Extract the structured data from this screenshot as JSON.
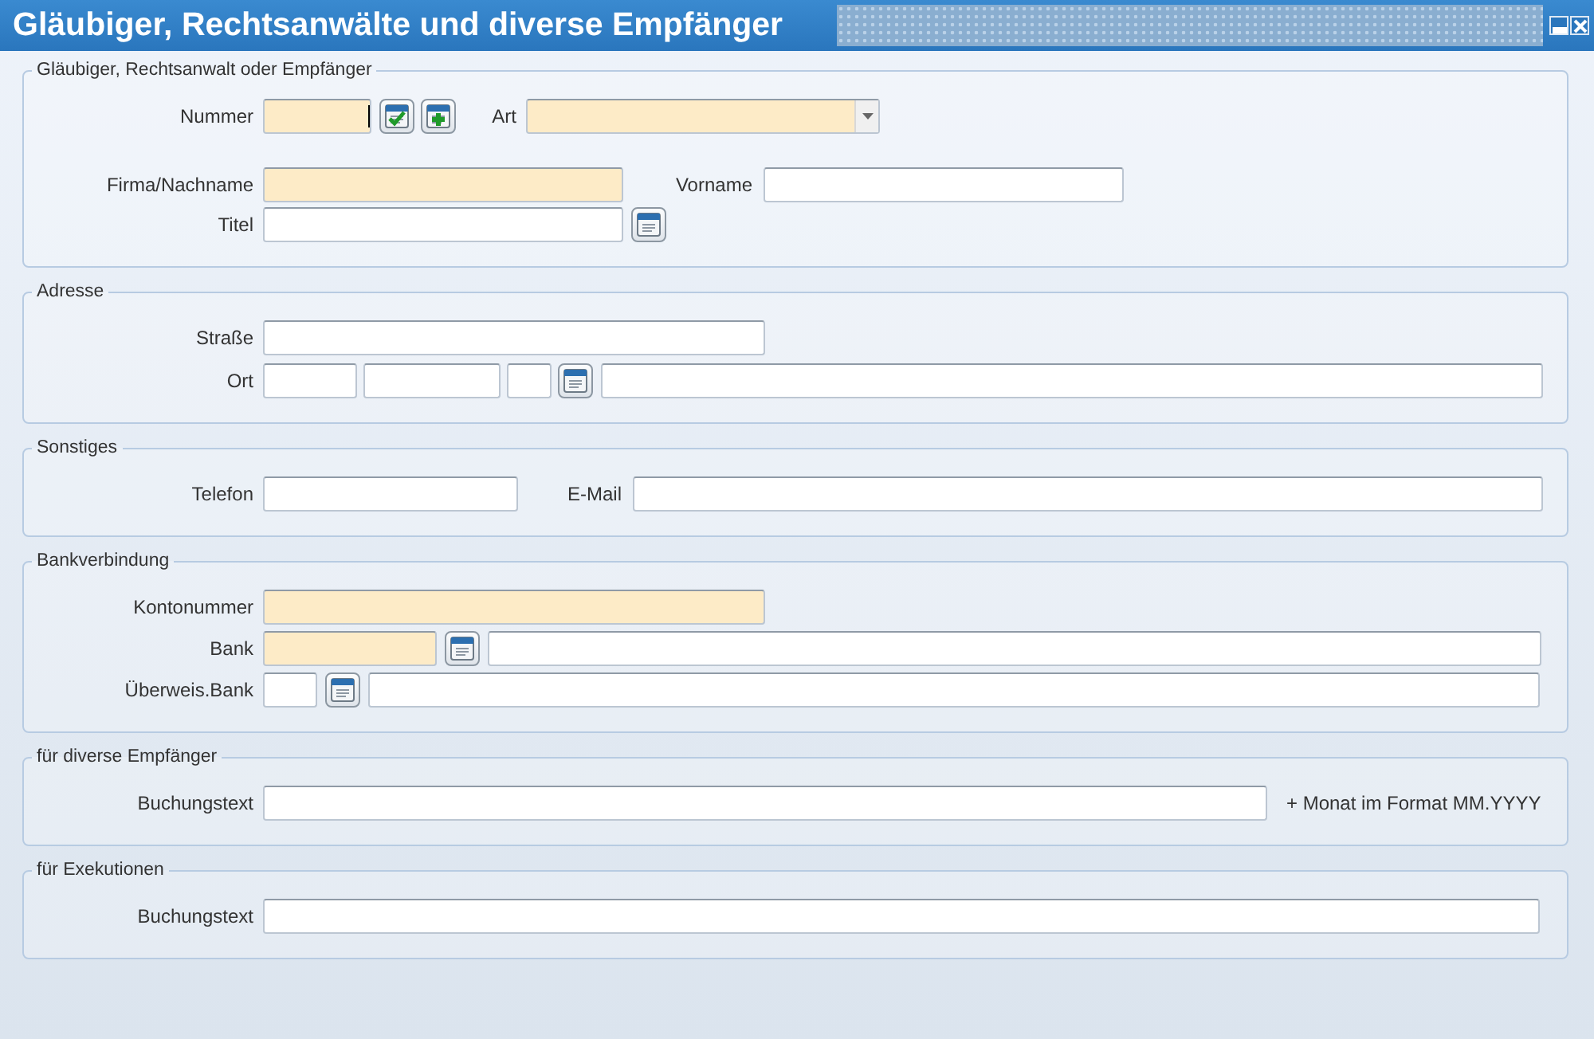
{
  "window": {
    "title": "Gläubiger, Rechtsanwälte und diverse Empfänger"
  },
  "sections": [
    {
      "legend": "Gläubiger, Rechtsanwalt oder Empfänger",
      "rows": [
        {
          "items": [
            {
              "kind": "label",
              "text": "Nummer"
            },
            {
              "kind": "field",
              "required": true,
              "focused": true
            },
            {
              "kind": "check-button"
            },
            {
              "kind": "add-button"
            },
            {
              "kind": "label",
              "text": "Art"
            },
            {
              "kind": "dropdown",
              "required": true
            }
          ]
        },
        {
          "items": [
            {
              "kind": "label",
              "text": "Firma/Nachname"
            },
            {
              "kind": "field",
              "required": true,
              "focused": false
            },
            {
              "kind": "label",
              "text": "Vorname"
            },
            {
              "kind": "field",
              "required": false,
              "focused": false
            }
          ]
        },
        {
          "items": [
            {
              "kind": "label",
              "text": "Titel"
            },
            {
              "kind": "field",
              "required": false,
              "focused": false
            },
            {
              "kind": "lookup-button"
            }
          ]
        }
      ]
    },
    {
      "legend": "Adresse",
      "rows": [
        {
          "items": [
            {
              "kind": "label",
              "text": "Straße"
            },
            {
              "kind": "field",
              "required": false,
              "focused": false
            }
          ]
        },
        {
          "items": [
            {
              "kind": "label",
              "text": "Ort"
            },
            {
              "kind": "field",
              "required": false,
              "focused": false
            },
            {
              "kind": "field",
              "required": false,
              "focused": false
            },
            {
              "kind": "field",
              "required": false,
              "focused": false
            },
            {
              "kind": "lookup-button"
            },
            {
              "kind": "field",
              "required": false,
              "focused": false
            }
          ]
        }
      ]
    },
    {
      "legend": "Sonstiges",
      "rows": [
        {
          "items": [
            {
              "kind": "label",
              "text": "Telefon"
            },
            {
              "kind": "field",
              "required": false,
              "focused": false
            },
            {
              "kind": "label",
              "text": "E-Mail"
            },
            {
              "kind": "field",
              "required": false,
              "focused": false
            }
          ]
        }
      ]
    },
    {
      "legend": "Bankverbindung",
      "rows": [
        {
          "items": [
            {
              "kind": "label",
              "text": "Kontonummer"
            },
            {
              "kind": "field",
              "required": true,
              "focused": false
            }
          ]
        },
        {
          "items": [
            {
              "kind": "label",
              "text": "Bank"
            },
            {
              "kind": "field",
              "required": true,
              "focused": false
            },
            {
              "kind": "lookup-button"
            },
            {
              "kind": "field",
              "required": false,
              "focused": false
            }
          ]
        },
        {
          "items": [
            {
              "kind": "label",
              "text": "Überweis.Bank"
            },
            {
              "kind": "field",
              "required": false,
              "focused": false
            },
            {
              "kind": "lookup-button"
            },
            {
              "kind": "field",
              "required": false,
              "focused": false
            }
          ]
        }
      ]
    },
    {
      "legend": "für diverse Empfänger",
      "rows": [
        {
          "items": [
            {
              "kind": "label",
              "text": "Buchungstext"
            },
            {
              "kind": "field",
              "required": false,
              "focused": false
            },
            {
              "kind": "note",
              "text": "+ Monat im Format MM.YYYY"
            }
          ]
        }
      ]
    },
    {
      "legend": "für Exekutionen",
      "rows": [
        {
          "items": [
            {
              "kind": "label",
              "text": "Buchungstext"
            },
            {
              "kind": "field",
              "required": false,
              "focused": false
            }
          ]
        }
      ]
    }
  ]
}
